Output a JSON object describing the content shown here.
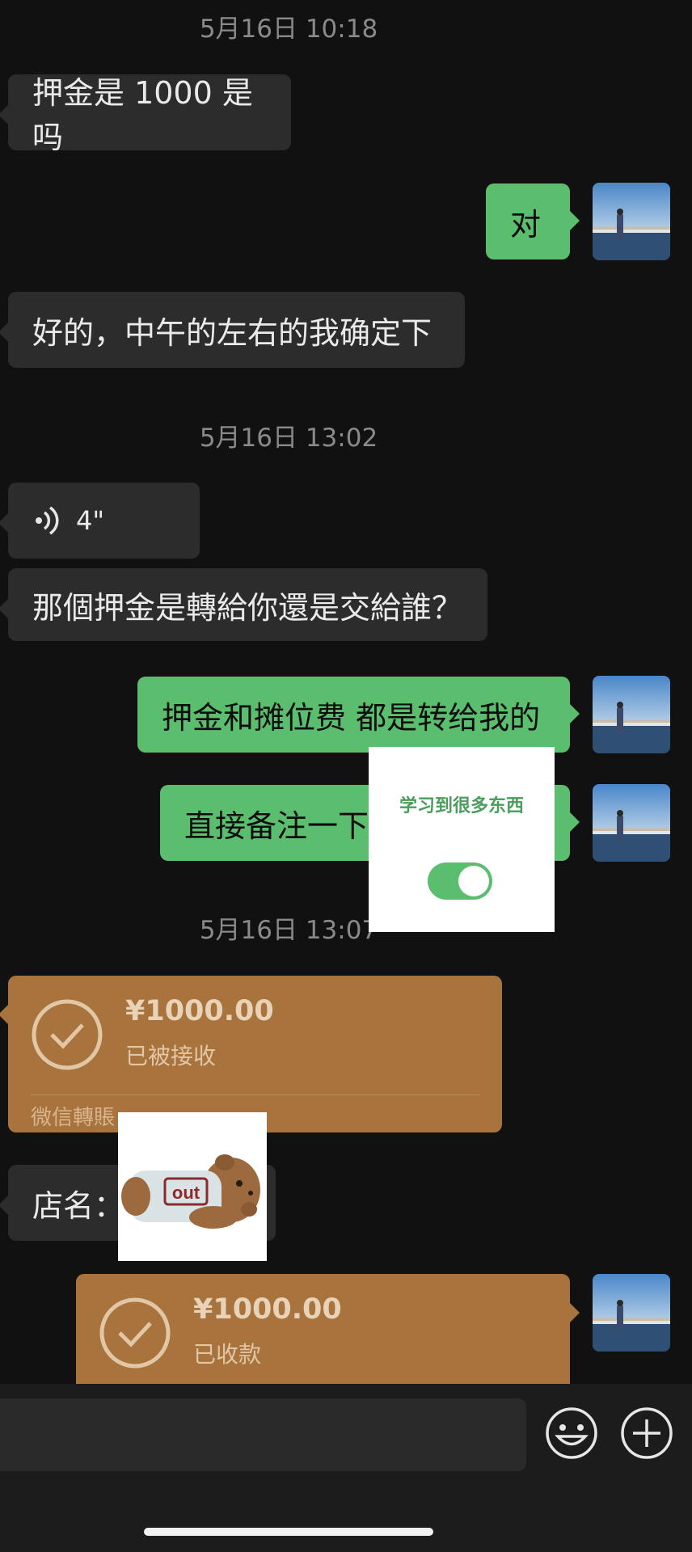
{
  "messages": {
    "ts1": "5月16日 10:18",
    "m1": "押金是 1000 是吗",
    "m2": "对",
    "m3": "好的，中午的左右的我确定下",
    "ts2": "5月16日 13:02",
    "voice_duration": "4\"",
    "m4": "那個押金是轉給你還是交給誰？",
    "m5": "押金和摊位费 都是转给我的",
    "m6": "直接备注一下",
    "ts3": "5月16日 13:07",
    "m7": "店名："
  },
  "transfers": [
    {
      "amount": "¥1000.00",
      "status": "已被接收",
      "source": "微信轉賬"
    },
    {
      "amount": "¥1000.00",
      "status": "已收款"
    }
  ],
  "overlay": {
    "text": "学习到很多东西",
    "toggle_on": true,
    "accent": "#5bbd6e"
  },
  "sticker": {
    "label": "out"
  },
  "colors": {
    "background": "#111111",
    "outgoing": "#5bbd6e",
    "incoming": "#2c2c2c",
    "transfer": "#a8733c"
  },
  "icons": [
    "voice-icon",
    "check-circle-icon",
    "emoji-icon",
    "plus-icon"
  ]
}
